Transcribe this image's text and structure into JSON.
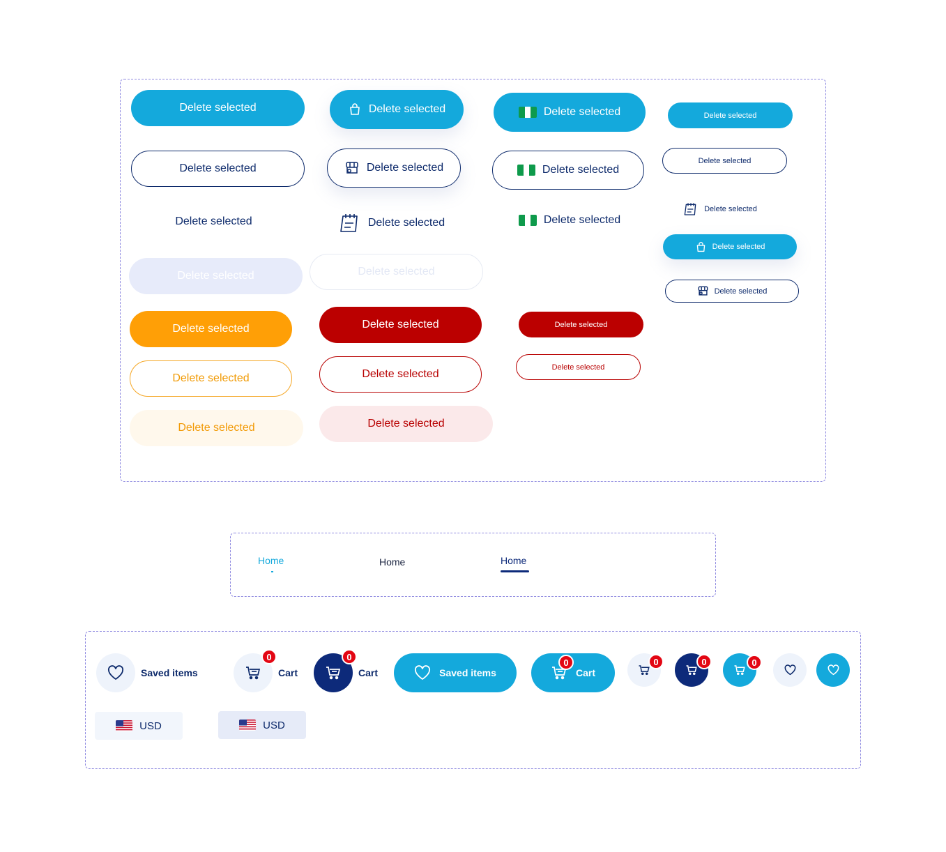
{
  "buttons": {
    "label": "Delete selected"
  },
  "tabs": {
    "home": "Home"
  },
  "nav": {
    "saved_items": "Saved items",
    "cart": "Cart",
    "badge_count": "0"
  },
  "currency": {
    "code": "USD",
    "flag_icon": "us-flag-icon"
  },
  "colors": {
    "primary": "#14a9dc",
    "navy": "#0d2a6b",
    "orange": "#ff9f06",
    "red": "#bb0000",
    "badge": "#e30613"
  }
}
